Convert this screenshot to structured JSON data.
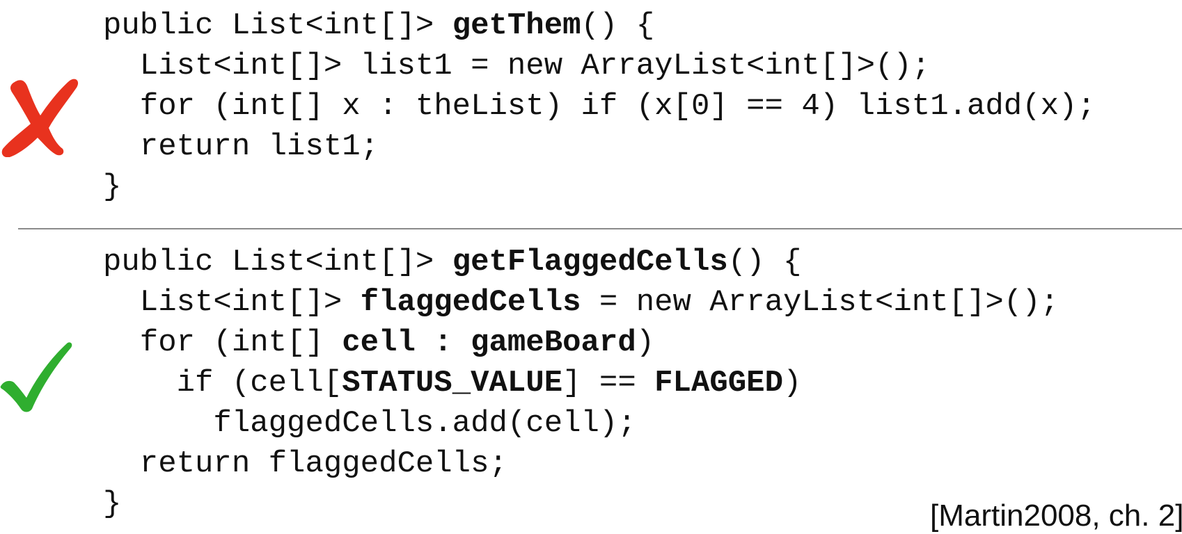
{
  "bad_example": {
    "lines": [
      [
        "public List<int[]> ",
        "getThem",
        "() {"
      ],
      [
        "  List<int[]> list1 = new ArrayList<int[]>();"
      ],
      [
        "  for (int[] x : theList) if (x[0] == 4) list1.add(x);"
      ],
      [
        "  return list1;"
      ],
      [
        "}"
      ]
    ]
  },
  "good_example": {
    "lines": [
      [
        "public List<int[]> ",
        "getFlaggedCells",
        "() {"
      ],
      [
        "  List<int[]> ",
        "flaggedCells",
        " = new ArrayList<int[]>();"
      ],
      [
        "  for (int[] ",
        "cell : gameBoard",
        ")"
      ],
      [
        "    if (cell[",
        "STATUS_VALUE",
        "] == ",
        "FLAGGED",
        ")"
      ],
      [
        "      flaggedCells.add(cell);"
      ],
      [
        "  return flaggedCells;"
      ],
      [
        "}"
      ]
    ]
  },
  "marks": {
    "bad": "cross-icon",
    "good": "checkmark-icon",
    "bad_color": "#e8321e",
    "good_color": "#2fae2f"
  },
  "citation": "[Martin2008, ch. 2]"
}
